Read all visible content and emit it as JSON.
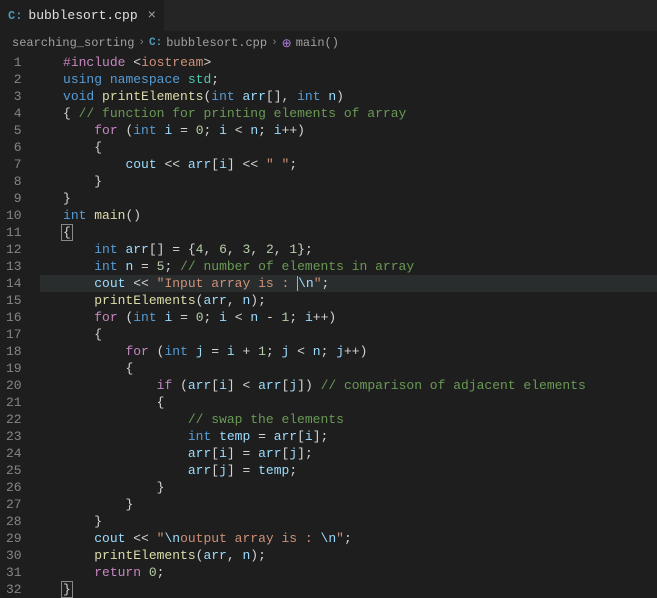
{
  "tab": {
    "icon": "C:",
    "label": "bubblesort.cpp",
    "close": "×"
  },
  "breadcrumb": {
    "folder": "searching_sorting",
    "fileIcon": "C:",
    "file": "bubblesort.cpp",
    "symbolIcon": "⊕",
    "symbol": "main()"
  },
  "lineNumbers": [
    "1",
    "2",
    "3",
    "4",
    "5",
    "6",
    "7",
    "8",
    "9",
    "10",
    "11",
    "12",
    "13",
    "14",
    "15",
    "16",
    "17",
    "18",
    "19",
    "20",
    "21",
    "22",
    "23",
    "24",
    "25",
    "26",
    "27",
    "28",
    "29",
    "30",
    "31",
    "32"
  ],
  "code": {
    "l1": {
      "include": "#include",
      "lt": "<",
      "iostream": "iostream",
      "gt": ">"
    },
    "l2": {
      "using": "using",
      "namespace": "namespace",
      "std": "std",
      "semi": ";"
    },
    "l3": {
      "void": "void",
      "fn": "printElements",
      "op": "(",
      "int": "int",
      "arr": "arr",
      "br": "[]",
      "comma": ", ",
      "int2": "int",
      "n": "n",
      "cp": ")"
    },
    "l4": {
      "ob": "{",
      "comment": "// function for printing elements of array"
    },
    "l5": {
      "for": "for",
      "op": "(",
      "int": "int",
      "i": "i",
      "eq": " = ",
      "zero": "0",
      "semi": "; ",
      "i2": "i",
      "lt": " < ",
      "n": "n",
      "semi2": "; ",
      "i3": "i",
      "pp": "++",
      "cp": ")"
    },
    "l6": {
      "ob": "{"
    },
    "l7": {
      "cout": "cout",
      "lt": " << ",
      "arr": "arr",
      "ob": "[",
      "i": "i",
      "cb": "]",
      "lt2": " << ",
      "str": "\" \"",
      "semi": ";"
    },
    "l8": {
      "cb": "}"
    },
    "l9": {
      "cb": "}"
    },
    "l10": {
      "int": "int",
      "main": "main",
      "p": "()"
    },
    "l11": {
      "ob": "{"
    },
    "l12": {
      "int": "int",
      "arr": "arr",
      "br": "[]",
      "eq": " = ",
      "ob": "{",
      "v1": "4",
      "c": ", ",
      "v2": "6",
      "c2": ", ",
      "v3": "3",
      "c3": ", ",
      "v4": "2",
      "c4": ", ",
      "v5": "1",
      "cb": "}",
      "semi": ";"
    },
    "l13": {
      "int": "int",
      "n": "n",
      "eq": " = ",
      "five": "5",
      "semi": "; ",
      "comment": "// number of elements in array"
    },
    "l14": {
      "cout": "cout",
      "lt": " << ",
      "str": "\"Input array is : ",
      "esc": "\\n",
      "strEnd": "\"",
      "semi": ";"
    },
    "l15": {
      "fn": "printElements",
      "op": "(",
      "arr": "arr",
      "comma": ", ",
      "n": "n",
      "cp": ")",
      "semi": ";"
    },
    "l16": {
      "for": "for",
      "op": "(",
      "int": "int",
      "i": "i",
      "eq": " = ",
      "zero": "0",
      "semi": "; ",
      "i2": "i",
      "lt": " < ",
      "n": "n",
      "minus": " - ",
      "one": "1",
      "semi2": "; ",
      "i3": "i",
      "pp": "++",
      "cp": ")"
    },
    "l17": {
      "ob": "{"
    },
    "l18": {
      "for": "for",
      "op": "(",
      "int": "int",
      "j": "j",
      "eq": " = ",
      "i": "i",
      "plus": " + ",
      "one": "1",
      "semi": "; ",
      "j2": "j",
      "lt": " < ",
      "n": "n",
      "semi2": "; ",
      "j3": "j",
      "pp": "++",
      "cp": ")"
    },
    "l19": {
      "ob": "{"
    },
    "l20": {
      "if": "if",
      "op": "(",
      "arr": "arr",
      "ob": "[",
      "i": "i",
      "cb": "]",
      "lt": " < ",
      "arr2": "arr",
      "ob2": "[",
      "j": "j",
      "cb2": "]",
      "cp": ") ",
      "comment": "// comparison of adjacent elements"
    },
    "l21": {
      "ob": "{"
    },
    "l22": {
      "comment": "// swap the elements"
    },
    "l23": {
      "int": "int",
      "temp": "temp",
      "eq": " = ",
      "arr": "arr",
      "ob": "[",
      "i": "i",
      "cb": "]",
      "semi": ";"
    },
    "l24": {
      "arr": "arr",
      "ob": "[",
      "i": "i",
      "cb": "]",
      "eq": " = ",
      "arr2": "arr",
      "ob2": "[",
      "j": "j",
      "cb2": "]",
      "semi": ";"
    },
    "l25": {
      "arr": "arr",
      "ob": "[",
      "j": "j",
      "cb": "]",
      "eq": " = ",
      "temp": "temp",
      "semi": ";"
    },
    "l26": {
      "cb": "}"
    },
    "l27": {
      "cb": "}"
    },
    "l28": {
      "cb": "}"
    },
    "l29": {
      "cout": "cout",
      "lt": " << ",
      "str": "\"",
      "esc": "\\n",
      "str2": "output array is : ",
      "esc2": "\\n",
      "strEnd": "\"",
      "semi": ";"
    },
    "l30": {
      "fn": "printElements",
      "op": "(",
      "arr": "arr",
      "comma": ", ",
      "n": "n",
      "cp": ")",
      "semi": ";"
    },
    "l31": {
      "return": "return",
      "zero": "0",
      "semi": ";"
    },
    "l32": {
      "cb": "}"
    }
  }
}
